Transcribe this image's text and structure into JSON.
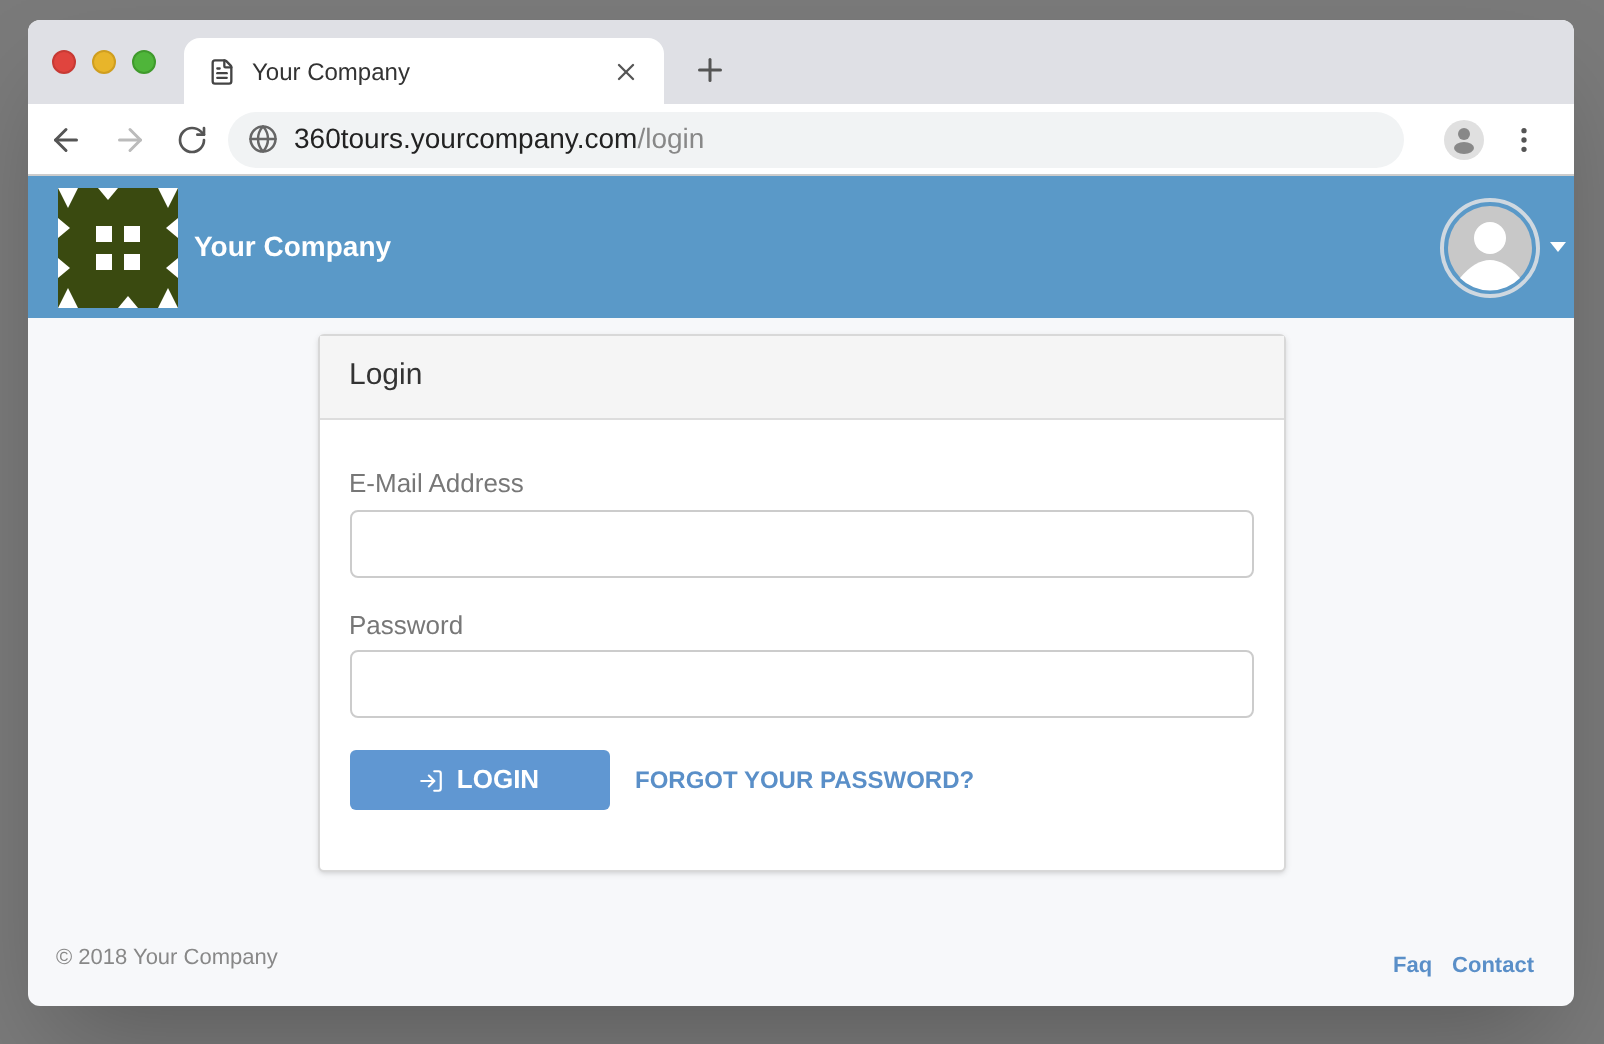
{
  "browser": {
    "tab_title": "Your Company",
    "url_host": "360tours.yourcompany.com",
    "url_path": "/login"
  },
  "header": {
    "brand": "Your Company"
  },
  "login": {
    "title": "Login",
    "fields": [
      {
        "label": "E-Mail Address"
      },
      {
        "label": "Password"
      }
    ],
    "submit": "LOGIN",
    "forgot": "FORGOT YOUR PASSWORD?"
  },
  "footer": {
    "copyright": "© 2018 Your Company",
    "links": [
      "Faq",
      "Contact"
    ]
  }
}
